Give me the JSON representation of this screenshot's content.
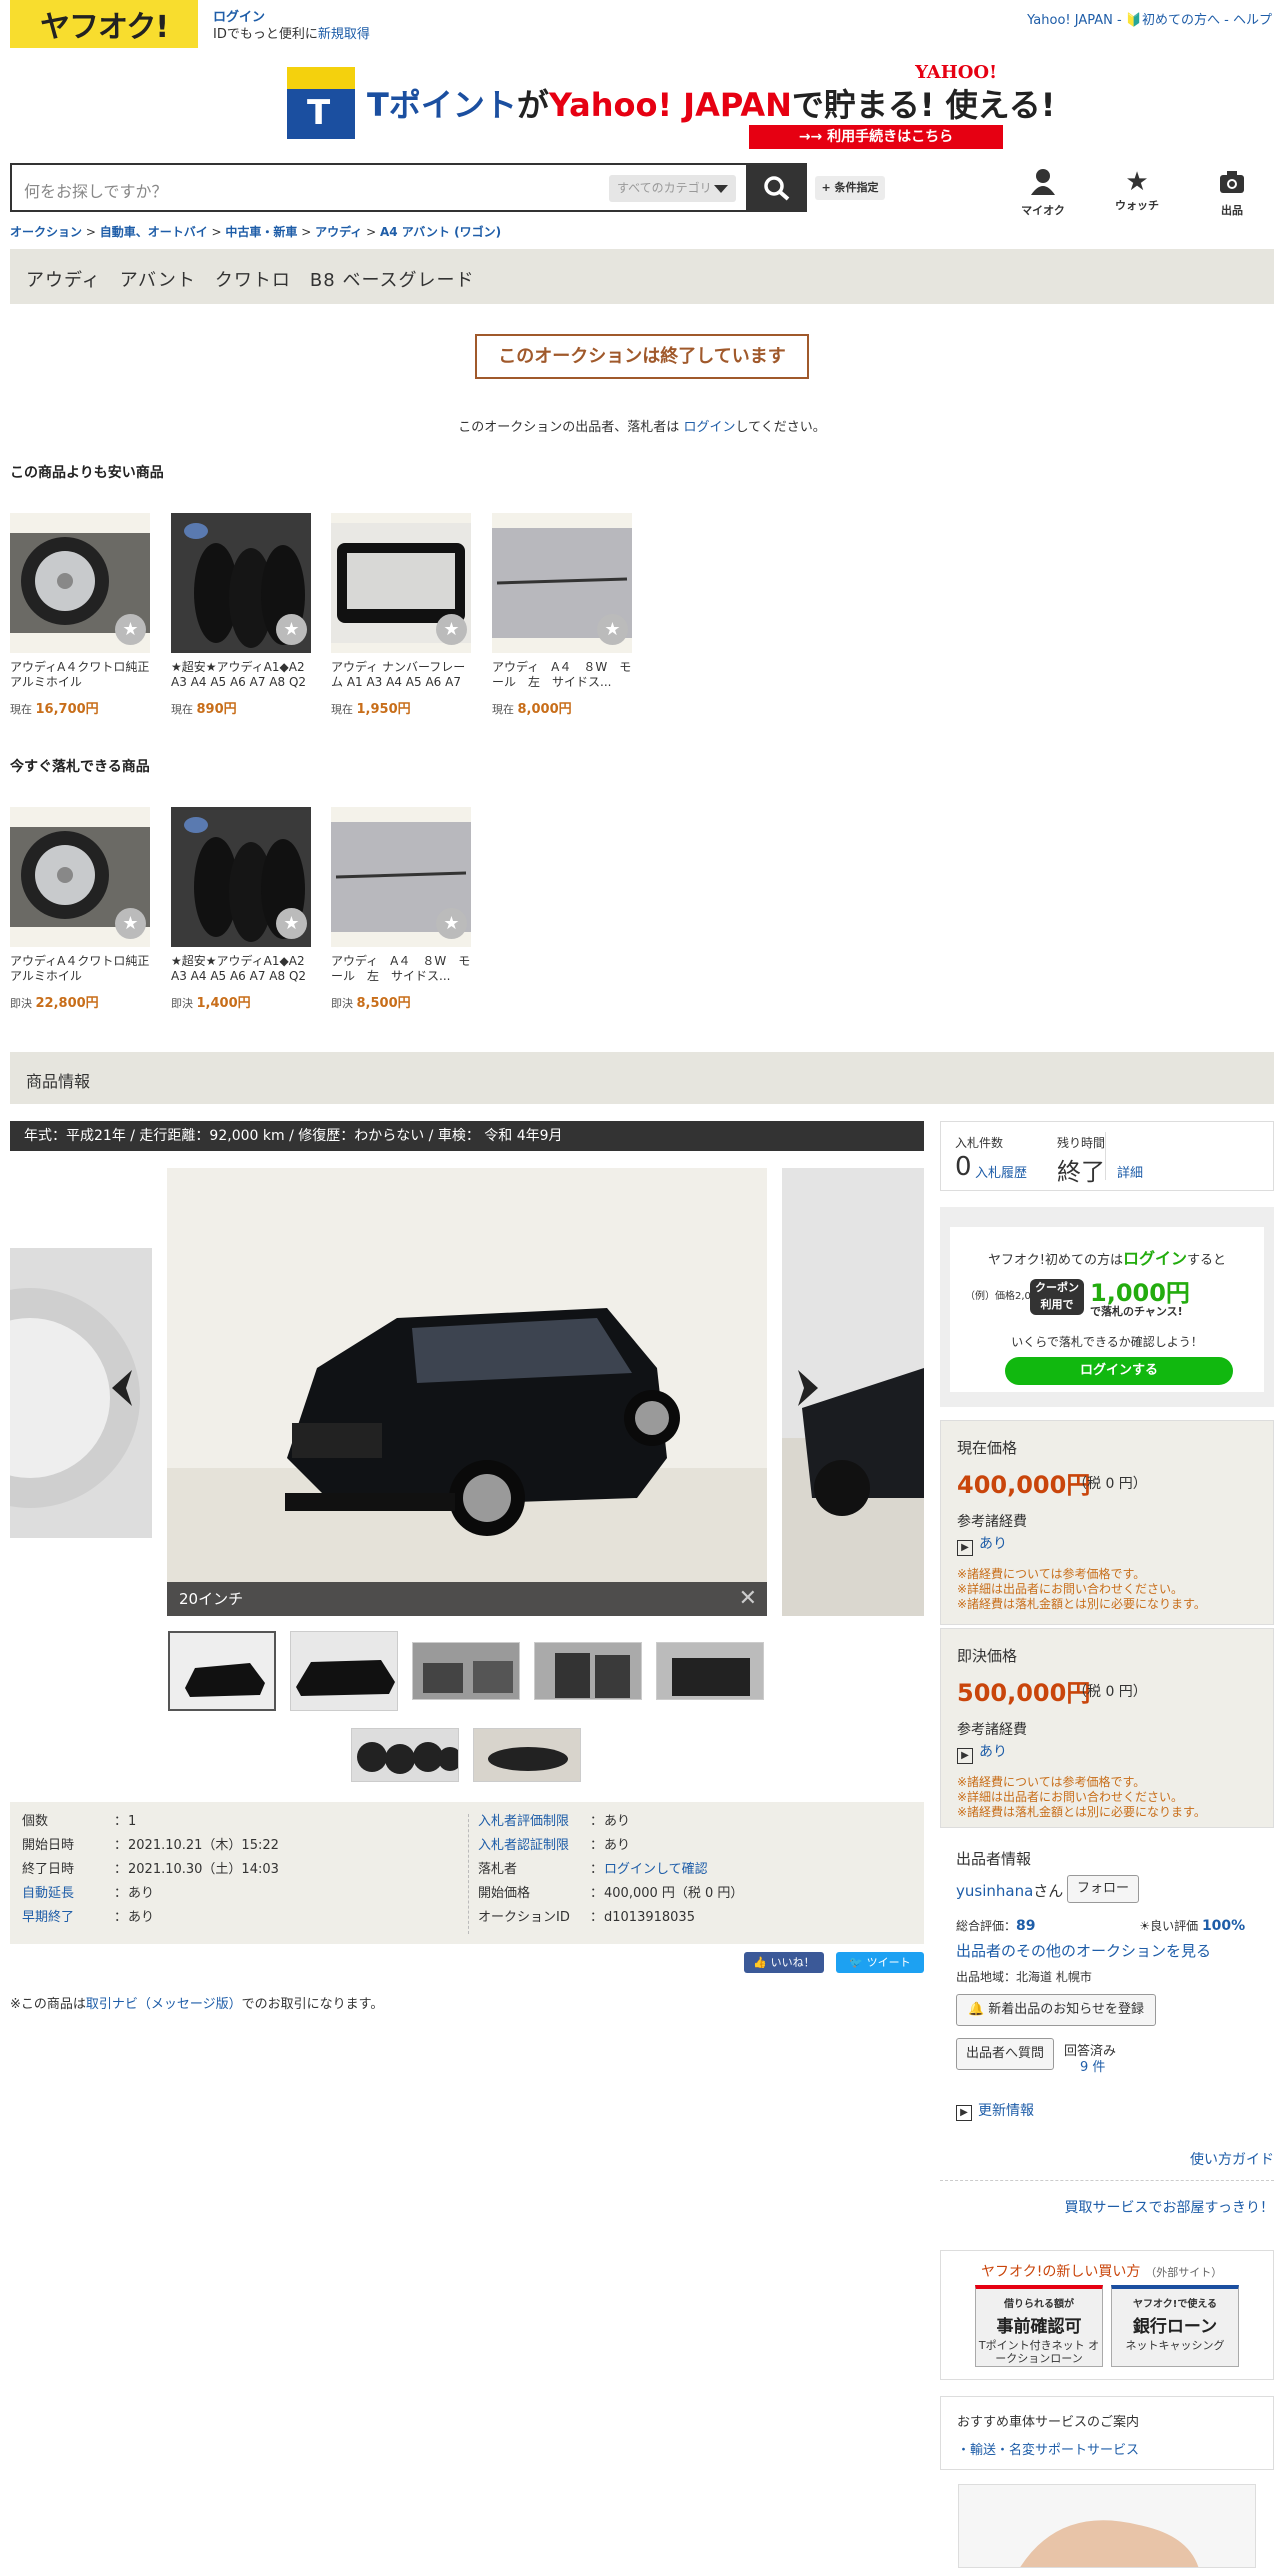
{
  "header": {
    "logo": "ヤフオク!",
    "login": "ログイン",
    "login_sub_prefix": "IDでもっと便利に",
    "signup": "新規取得",
    "top_links": "Yahoo! JAPAN - 🔰初めての方へ - ヘルプ"
  },
  "banner": {
    "t_mark": "T",
    "part1": "Tポイント",
    "part2": "が",
    "part3": "Yahoo! JAPAN",
    "part4": "で",
    "part5": "貯まる! 使える!",
    "yahoo_logo": "YAHOO!",
    "button": "→→ 利用手続きはこちら"
  },
  "search": {
    "placeholder": "何をお探しですか？",
    "category": "すべてのカテゴリ",
    "condition": "+ 条件指定"
  },
  "nav_icons": [
    {
      "label": "マイオク",
      "icon": "user-icon"
    },
    {
      "label": "ウォッチ",
      "icon": "star-icon"
    },
    {
      "label": "出品",
      "icon": "camera-icon"
    }
  ],
  "breadcrumb": [
    "オークション",
    "自動車、オートバイ",
    "中古車・新車",
    "アウディ",
    "A4 アバント (ワゴン)"
  ],
  "title": "アウディ　アバント　クワトロ　B8 ベースグレード",
  "ended_label": "このオークションは終了しています",
  "ended_note_prefix": "このオークションの出品者、落札者は",
  "ended_note_link": "ログイン",
  "ended_note_suffix": "してください。",
  "cheaper": {
    "heading": "この商品よりも安い商品",
    "items": [
      {
        "name": "アウディA４クワトロ純正アルミホイル",
        "label": "現在",
        "price": "16,700円"
      },
      {
        "name": "★超安★アウディA1◆A2 A3 A4 A5 A6 A7 A8 Q2 ...",
        "label": "現在",
        "price": "890円"
      },
      {
        "name": "アウディ ナンバーフレーム A1 A3 A4 A5 A6 A7 A...",
        "label": "現在",
        "price": "1,950円"
      },
      {
        "name": "アウディ　A４　８W　モール　左　サイドス...",
        "label": "現在",
        "price": "8,000円"
      }
    ]
  },
  "buynow": {
    "heading": "今すぐ落札できる商品",
    "items": [
      {
        "name": "アウディA４クワトロ純正アルミホイル",
        "label": "即決",
        "price": "22,800円"
      },
      {
        "name": "★超安★アウディA1◆A2 A3 A4 A5 A6 A7 A8 Q2 ...",
        "label": "即決",
        "price": "1,400円"
      },
      {
        "name": "アウディ　A４　８W　モール　左　サイドス...",
        "label": "即決",
        "price": "8,500円"
      }
    ]
  },
  "product_info_heading": "商品情報",
  "spec_bar": "年式：平成21年 / 走行距離：92,000 km / 修復歴：わからない / 車検： 令和 4年9月",
  "image_caption": "20インチ",
  "details_left": [
    {
      "key": "個数",
      "value": "1"
    },
    {
      "key": "開始日時",
      "value": "2021.10.21（木）15:22"
    },
    {
      "key": "終了日時",
      "value": "2021.10.30（土）14:03"
    },
    {
      "key": "自動延長",
      "value": "あり"
    },
    {
      "key": "早期終了",
      "value": "あり"
    }
  ],
  "details_right": [
    {
      "key": "入札者評価制限",
      "value": "あり"
    },
    {
      "key": "入札者認証制限",
      "value": "あり"
    },
    {
      "key": "落札者",
      "value": "ログインして確認"
    },
    {
      "key": "開始価格",
      "value": "400,000 円（税 0 円）"
    },
    {
      "key": "オークションID",
      "value": "d1013918035"
    }
  ],
  "sns": {
    "like": "👍 いいね！",
    "tweet": "🐦 ツイート"
  },
  "navi_note": {
    "prefix": "※この商品は",
    "link": "取引ナビ（メッセージ版）",
    "suffix": "でのお取引になります。"
  },
  "bid_box": {
    "bids_label": "入札件数",
    "bids": "0",
    "history": "入札履歴",
    "time_label": "残り時間",
    "time": "終了",
    "detail": "詳細"
  },
  "promo": {
    "line1_prefix": "ヤフオク!初めての方は",
    "line1_link": "ログイン",
    "line1_suffix": "すると",
    "example": "（例）価格2,000円",
    "coupon": "クーポン利用で",
    "amount": "1,000円",
    "amount_sub": "で落札のチャンス!",
    "line3": "いくらで落札できるか確認しよう！",
    "button": "ログインする"
  },
  "current_price": {
    "label": "現在価格",
    "value": "400,000円",
    "tax": "（税 0 円）",
    "ref": "参考諸経費",
    "ari": "あり",
    "notes": [
      "※諸経費については参考価格です。",
      "※詳細は出品者にお問い合わせください。",
      "※諸経費は落札金額とは別に必要になります。"
    ]
  },
  "buyout_price": {
    "label": "即決価格",
    "value": "500,000円",
    "tax": "（税 0 円）",
    "ref": "参考諸経費",
    "ari": "あり",
    "notes": [
      "※諸経費については参考価格です。",
      "※詳細は出品者にお問い合わせください。",
      "※諸経費は落札金額とは別に必要になります。"
    ]
  },
  "seller": {
    "heading": "出品者情報",
    "name": "yusinhana",
    "suffix": "さん",
    "follow": "フォロー",
    "score_label": "総合評価：",
    "score": "89",
    "good_label": "良い評価",
    "good": "100%",
    "others": "出品者のその他のオークションを見る",
    "area": "出品地域：北海道 札幌市",
    "notify": "新着出品のお知らせを登録",
    "question": "出品者へ質問",
    "answered": "回答済み",
    "answered_count": "9 件",
    "update": "更新情報"
  },
  "guide": "使い方ガイド",
  "kaitori": "買取サービスでお部屋すっきり！",
  "new_buy": {
    "heading": "ヤフオク!の新しい買い方",
    "heading_sub": "（外部サイト）",
    "b1": {
      "a": "借りられる額が",
      "b": "事前確認可",
      "c": "Tポイント付きネット オークションローン"
    },
    "b2": {
      "a": "ヤフオク!で使える",
      "b": "銀行ローン",
      "c": "ネットキャッシング"
    }
  },
  "recommend": {
    "heading": "おすすめ車体サービスのご案内",
    "link": "・輸送・名変サポートサービス"
  },
  "colors": {
    "brand_yellow": "#f8dd2e",
    "link_blue": "#1e5da8",
    "price_red": "#c9450b",
    "ended_brown": "#a0592b",
    "green": "#11b80f"
  }
}
